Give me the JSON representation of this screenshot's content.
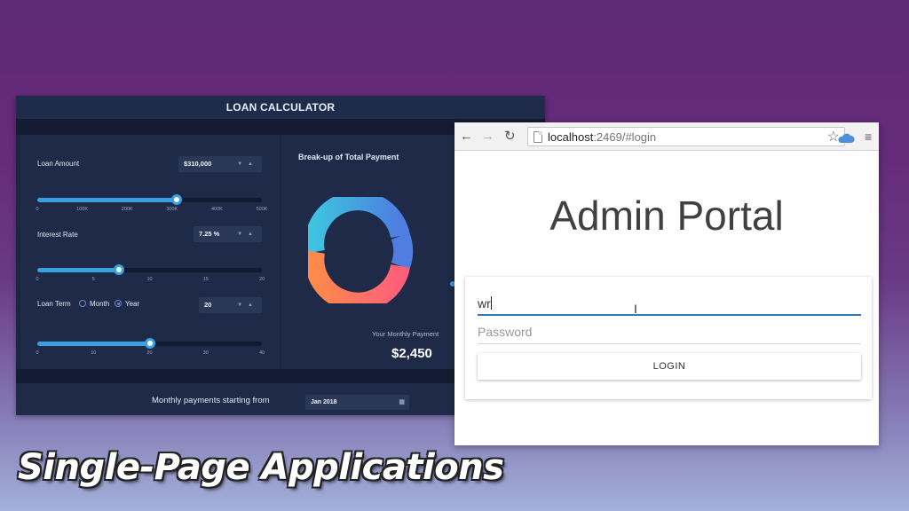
{
  "loan_app": {
    "title": "LOAN CALCULATOR",
    "loan_amount": {
      "label": "Loan Amount",
      "value": "$310,000",
      "slider_fraction": 0.62,
      "ticks": [
        "0",
        "100K",
        "200K",
        "300K",
        "400K",
        "500K"
      ]
    },
    "interest_rate": {
      "label": "Interest Rate",
      "value": "7.25 %",
      "slider_fraction": 0.365,
      "ticks": [
        "0",
        "5",
        "10",
        "15",
        "20"
      ]
    },
    "loan_term": {
      "label": "Loan Term",
      "option_month": "Month",
      "option_year": "Year",
      "selected": "Year",
      "value": "20",
      "slider_fraction": 0.5,
      "ticks": [
        "0",
        "10",
        "20",
        "30",
        "40"
      ]
    },
    "breakup": {
      "title": "Break-up of Total Payment",
      "donut_colors": [
        "#3ec3e0",
        "#4f7de0",
        "#ff6f6a",
        "#ff8a4a"
      ]
    },
    "monthly": {
      "label": "Your Monthly Payment",
      "value": "$2,450"
    },
    "start": {
      "label": "Monthly payments starting from",
      "value": "Jan 2018"
    }
  },
  "browser": {
    "url_host": "localhost",
    "url_path": ":2469/#login",
    "page_title": "Admin Portal",
    "username_value": "wr",
    "password_placeholder": "Password",
    "login_label": "LOGIN"
  },
  "caption": "Single-Page Applications"
}
